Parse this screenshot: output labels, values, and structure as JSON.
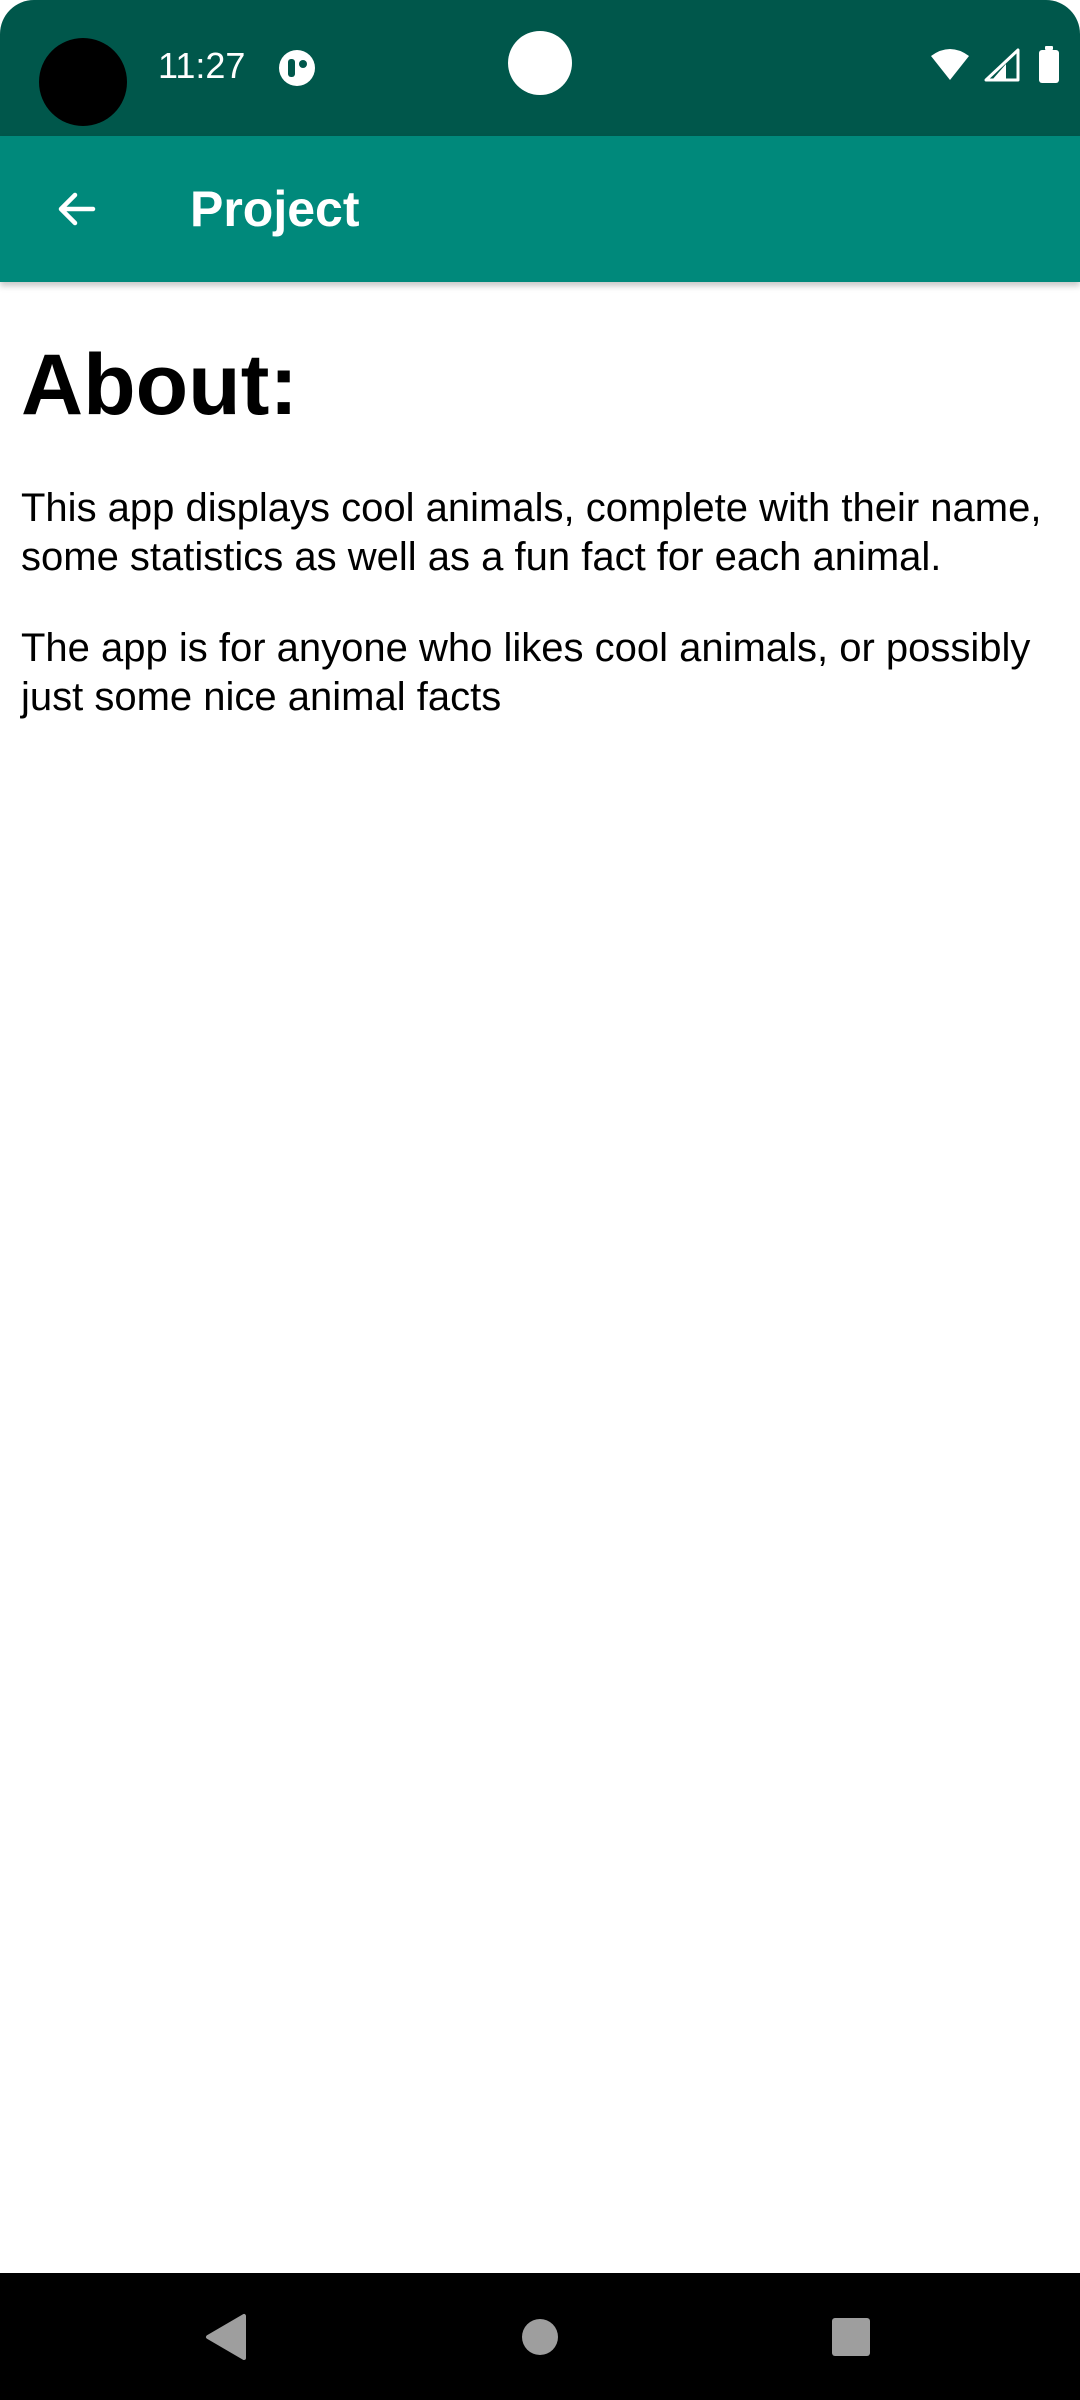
{
  "status_bar": {
    "time": "11:27",
    "background": "#00574b",
    "icons": [
      "app-notification-icon",
      "wifi-icon",
      "cell-signal-icon",
      "battery-icon"
    ]
  },
  "app_bar": {
    "title": "Project",
    "background": "#00897b",
    "back_icon": "arrow-back-icon"
  },
  "content": {
    "heading": "About:",
    "paragraphs": [
      "This app displays cool animals, complete with their name, some statistics as well as a fun fact for each animal.",
      "The app is for anyone who likes cool animals, or possibly just some nice animal facts"
    ]
  },
  "nav_bar": {
    "buttons": [
      "back-triangle-icon",
      "home-circle-icon",
      "recents-square-icon"
    ]
  }
}
